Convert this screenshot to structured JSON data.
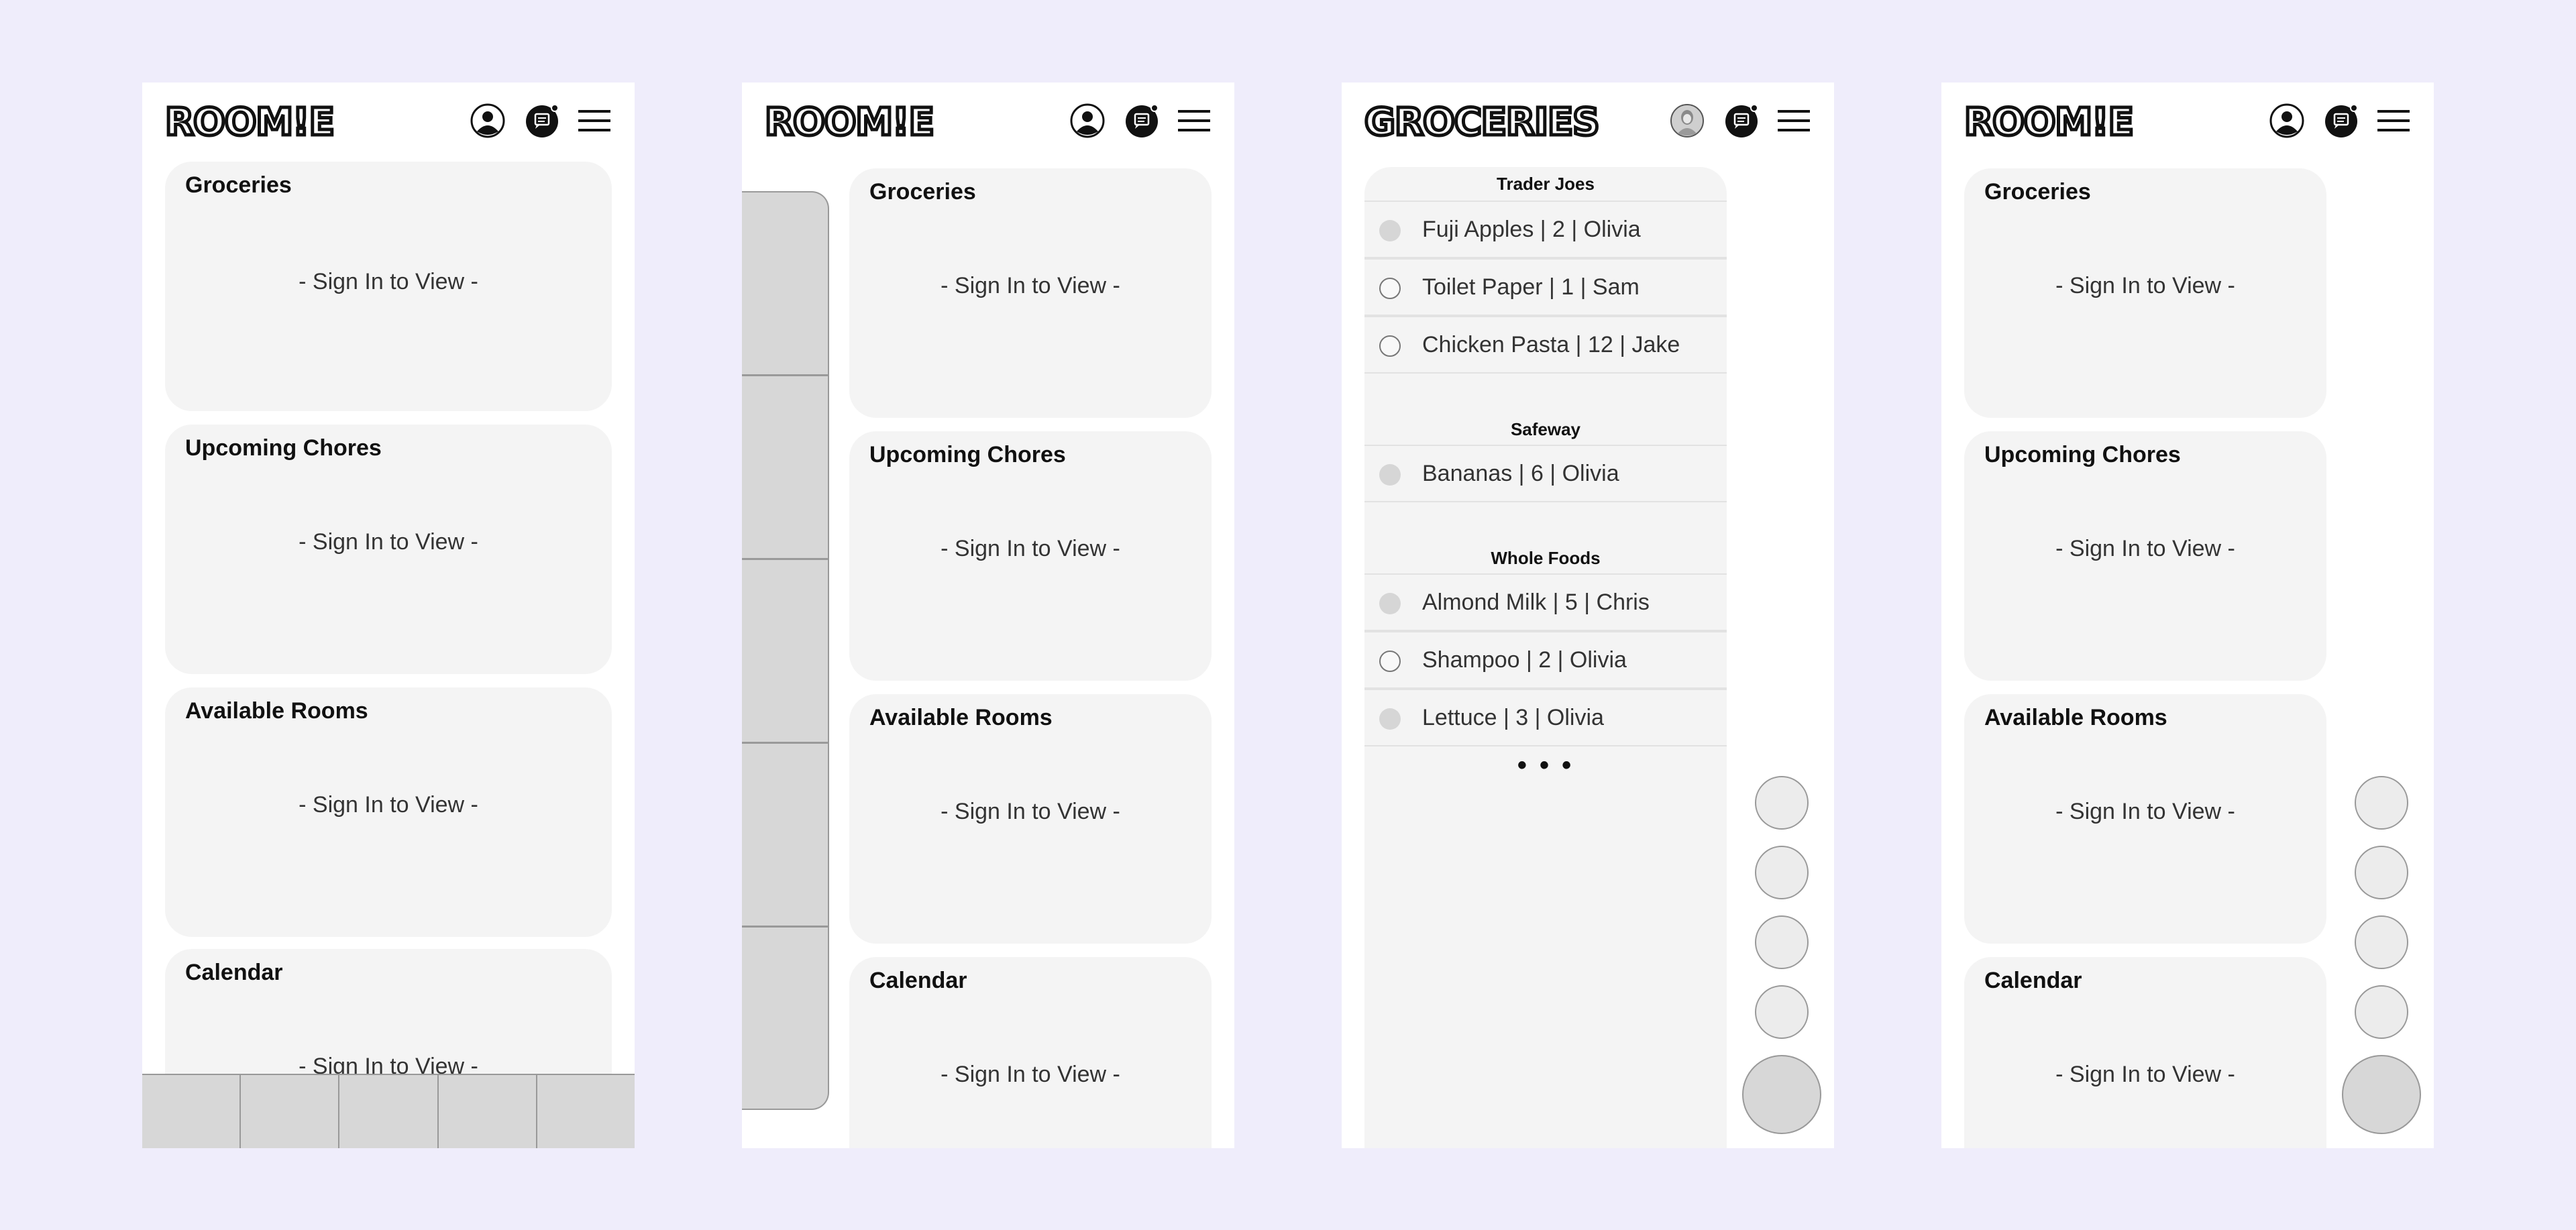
{
  "brand": "ROOM!E",
  "screen3_title": "GROCERIES",
  "sign_in_msg": "- Sign In to View -",
  "cards": {
    "groceries": "Groceries",
    "chores": "Upcoming Chores",
    "rooms": "Available Rooms",
    "calendar": "Calendar"
  },
  "icons": {
    "profile": "user-circle-icon",
    "messages": "chat-bubble-icon",
    "menu": "hamburger-menu-icon",
    "avatar": "user-photo-avatar"
  },
  "grocery_list": {
    "stores": [
      {
        "name": "Trader Joes",
        "items": [
          {
            "text": "Fuji Apples  |  2  |  Olivia",
            "checked": true
          },
          {
            "text": "Toilet Paper  |  1  |  Sam",
            "checked": false
          },
          {
            "text": "Chicken Pasta  |  12  |  Jake",
            "checked": false
          }
        ]
      },
      {
        "name": "Safeway",
        "items": [
          {
            "text": "Bananas  |  6  |  Olivia",
            "checked": true
          }
        ]
      },
      {
        "name": "Whole Foods",
        "items": [
          {
            "text": "Almond Milk  |  5  |  Chris",
            "checked": true
          },
          {
            "text": "Shampoo  |  2  |  Olivia",
            "checked": false
          },
          {
            "text": "Lettuce  |  3  |  Olivia",
            "checked": true
          }
        ]
      }
    ],
    "more": "• • •"
  },
  "colors": {
    "background": "#efedfb",
    "card": "#f4f4f4",
    "placeholder": "#d7d7d7",
    "text": "#111111"
  }
}
